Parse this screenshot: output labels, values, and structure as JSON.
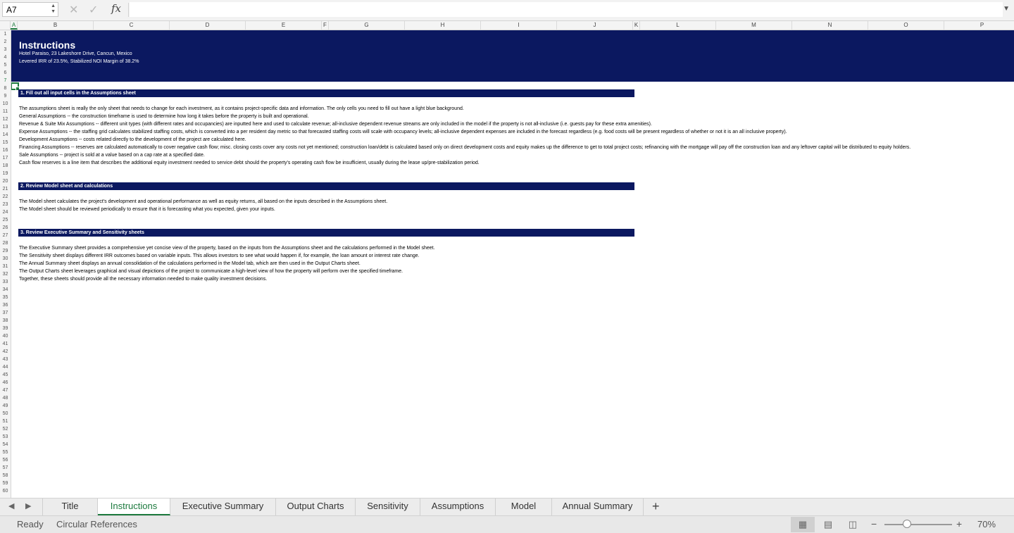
{
  "formula_bar": {
    "name_box": "A7",
    "formula": "",
    "cancel_icon": "x-icon",
    "confirm_icon": "check-icon",
    "fx_label": "fx"
  },
  "columns": [
    "A",
    "B",
    "C",
    "D",
    "E",
    "F",
    "G",
    "H",
    "I",
    "J",
    "K",
    "L",
    "M",
    "N",
    "O",
    "P"
  ],
  "selected_column": "A",
  "rows": {
    "first": 1,
    "last": 60,
    "selected": 7
  },
  "banner": {
    "title": "Instructions",
    "line1": "Hotel Paraiso, 23 Lakeshore Drive, Cancun, Mexico",
    "line2": "Levered IRR of 23.5%, Stabilized NOI Margin of 38.2%"
  },
  "sections": [
    {
      "heading": "1. Fill out all input cells in the Assumptions sheet",
      "lines": [
        "The assumptions sheet is really the only sheet that needs to change for each investment, as it contains project-specific data and information. The only cells you need to fill out have a light blue background.",
        "General Assumptions -- the construction timeframe is used to determine how long it takes before the property is built and operational.",
        "Revenue & Suite Mix Assumptions -- different unit types (with different rates and occupancies) are inputted here and used to calculate revenue; all-inclusive dependent revenue streams are only included in the model if the property is not all-inclusive (i.e. guests pay for these extra amenities).",
        "Expense Assumptions -- the staffing grid calculates stabilized staffing costs, which is converted into a per resident day metric so that forecasted staffing costs will scale with occupancy levels; all-inclusive dependent expenses are included in the forecast regardless (e.g. food costs will be present regardless of whether or not it is an all inclusive property).",
        "Development Assumptions -- costs related directly to the development of the project are calculated here.",
        "Financing Assumptions -- reserves are calculated automatically to cover negative cash flow; misc. closing costs cover any costs not yet mentioned; construction loan/debt is calculated based only on direct development costs and equity makes up the difference to get to total project costs; refinancing with the mortgage will pay off the construction loan and any leftover capital will be distributed to equity holders.",
        "Sale Assumptions -- project is sold at a value based on a cap rate at a specified date.",
        "Cash flow reserves is a line item that describes the additional equity investment needed to service debt should the property's operating cash flow be insufficient, usually during the lease up/pre-stabilization period."
      ]
    },
    {
      "heading": "2. Review Model sheet and calculations",
      "lines": [
        "The Model sheet calculates the project's development and operational performance as well as equity returns, all based on the inputs described in the Assumptions sheet.",
        "The Model sheet should be reviewed periodically to ensure that it is forecasting what you expected, given your inputs."
      ]
    },
    {
      "heading": "3. Review Executive Summary and Sensitivity sheets",
      "lines": [
        "The Executive Summary sheet provides a comprehensive yet concise view of the property, based on the inputs from the Assumptions sheet and the calculations performed in the Model sheet.",
        "The Sensitivity sheet displays different IRR outcomes based on variable inputs. This allows investors to see what would happen if, for example, the loan amount or interest rate change.",
        "The Annual Summary sheet displays an annual consolidation of the calculations performed in the Model tab, which are then used in the Output Charts sheet.",
        "The Output Charts sheet leverages graphical and visual depictions of the project to communicate a high-level view of how the property will perform over the specified timeframe.",
        "Together, these sheets should provide all the necessary information needed to make quality investment decisions."
      ]
    }
  ],
  "tabs": [
    "Title",
    "Instructions",
    "Executive Summary",
    "Output Charts",
    "Sensitivity",
    "Assumptions",
    "Model",
    "Annual Summary"
  ],
  "active_tab": "Instructions",
  "add_tab_label": "+",
  "status": {
    "ready": "Ready",
    "circular": "Circular References",
    "zoom": "70%",
    "zoom_minus": "−",
    "zoom_plus": "+",
    "zoom_level": 0.7
  },
  "colors": {
    "banner": "#0b1860",
    "accent": "#1d7a3e"
  }
}
